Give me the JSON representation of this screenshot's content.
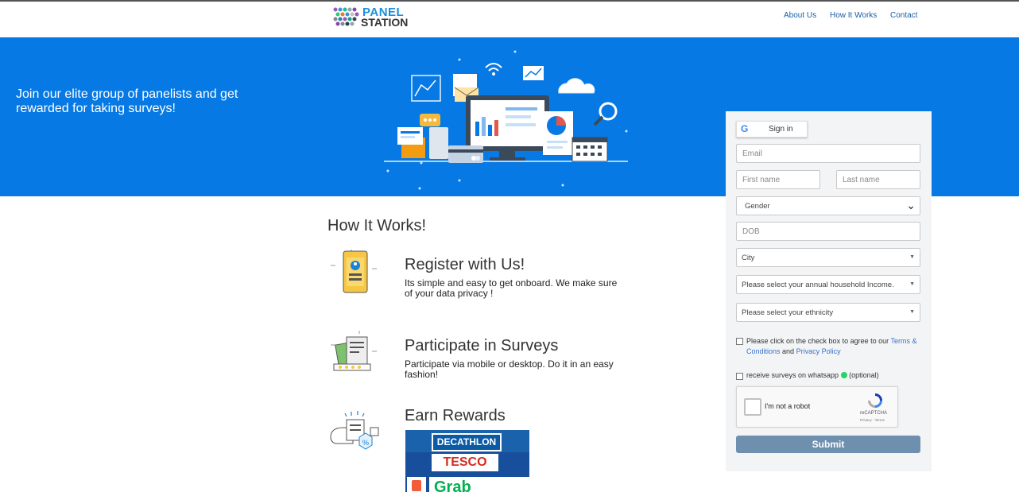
{
  "header": {
    "logo_line1": "PANEL",
    "logo_line2": "STATION",
    "nav": [
      {
        "label": "About Us"
      },
      {
        "label": "How It Works"
      },
      {
        "label": "Contact"
      }
    ]
  },
  "hero": {
    "tagline": "Join our elite group of panelists and get rewarded for taking surveys!"
  },
  "how_it_works": {
    "title": "How It Works!",
    "steps": [
      {
        "title": "Register with Us!",
        "desc": "Its simple and easy to get onboard. We make sure of your data privacy !"
      },
      {
        "title": "Participate in Surveys",
        "desc": "Participate via mobile or desktop. Do it in an easy fashion!"
      },
      {
        "title": "Earn Rewards",
        "desc": ""
      }
    ],
    "reward_brands": [
      "DECATHLON",
      "TESCO",
      "Grab"
    ]
  },
  "form": {
    "google_label": "Sign in",
    "email_placeholder": "Email",
    "first_name_placeholder": "First name",
    "last_name_placeholder": "Last name",
    "gender_value": "Gender",
    "dob_placeholder": "DOB",
    "city_value": "City",
    "income_value": "Please select your annual household Income.",
    "ethnicity_value": "Please select your ethnicity",
    "terms_text_1": "Please click on the check box to agree to our",
    "terms_link": "Terms & Conditions",
    "terms_and": "and",
    "privacy_link": "Privacy Policy",
    "whatsapp_text": "receive surveys on whatsapp",
    "whatsapp_optional": "(optional)",
    "captcha_label": "I'm not a robot",
    "captcha_brand": "reCAPTCHA",
    "captcha_terms": "Privacy - Terms",
    "submit_label": "Submit"
  },
  "colors": {
    "hero_bg": "#0779e4",
    "submit_bg": "#6f8fae",
    "nav_link": "#1a5ea8"
  }
}
